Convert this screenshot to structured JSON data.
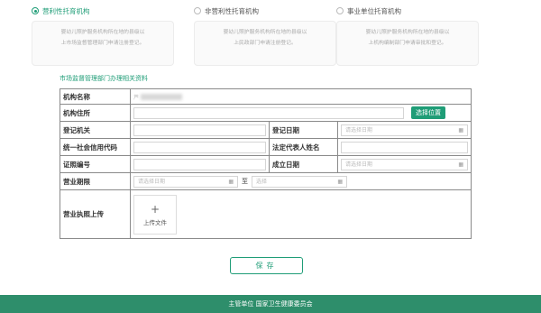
{
  "org_types": [
    {
      "title": "营利性托育机构",
      "desc_line1": "婴幼儿照护服务机构所在地的县级以",
      "desc_line2": "上市场监督管理部门申请注册登记。",
      "selected": true
    },
    {
      "title": "非营利性托育机构",
      "desc_line1": "婴幼儿照护服务机构所在地的县级以",
      "desc_line2": "上民政部门申请注册登记。",
      "selected": false
    },
    {
      "title": "事业单位托育机构",
      "desc_line1": "婴幼儿照护服务机构所在地的县级以",
      "desc_line2": "上机构编制部门申请审批和登记。",
      "selected": false
    }
  ],
  "section_title": "市场监督管理部门办理相关资料",
  "form": {
    "org_name_label": "机构名称",
    "org_name_value_prefix": "芦",
    "org_address_label": "机构住所",
    "select_location_btn": "选择位置",
    "reg_authority_label": "登记机关",
    "reg_date_label": "登记日期",
    "reg_date_placeholder": "请选择日期",
    "credit_code_label": "统一社会信用代码",
    "legal_rep_label": "法定代表人姓名",
    "license_no_label": "证照编号",
    "founded_date_label": "成立日期",
    "founded_date_placeholder": "请选择日期",
    "term_label": "营业期限",
    "term_start_placeholder": "请选择日期",
    "term_to": "至",
    "term_end_placeholder": "选择",
    "upload_label": "营业执照上传",
    "upload_plus": "+",
    "upload_btn": "上传文件"
  },
  "save_label": "保存",
  "footer_text": "主管单位 国家卫生健康委员会",
  "colors": {
    "accent": "#1f9d77",
    "footer": "#2e8e6b"
  },
  "icons": {
    "calendar": "calendar-icon",
    "plus": "plus-icon"
  }
}
